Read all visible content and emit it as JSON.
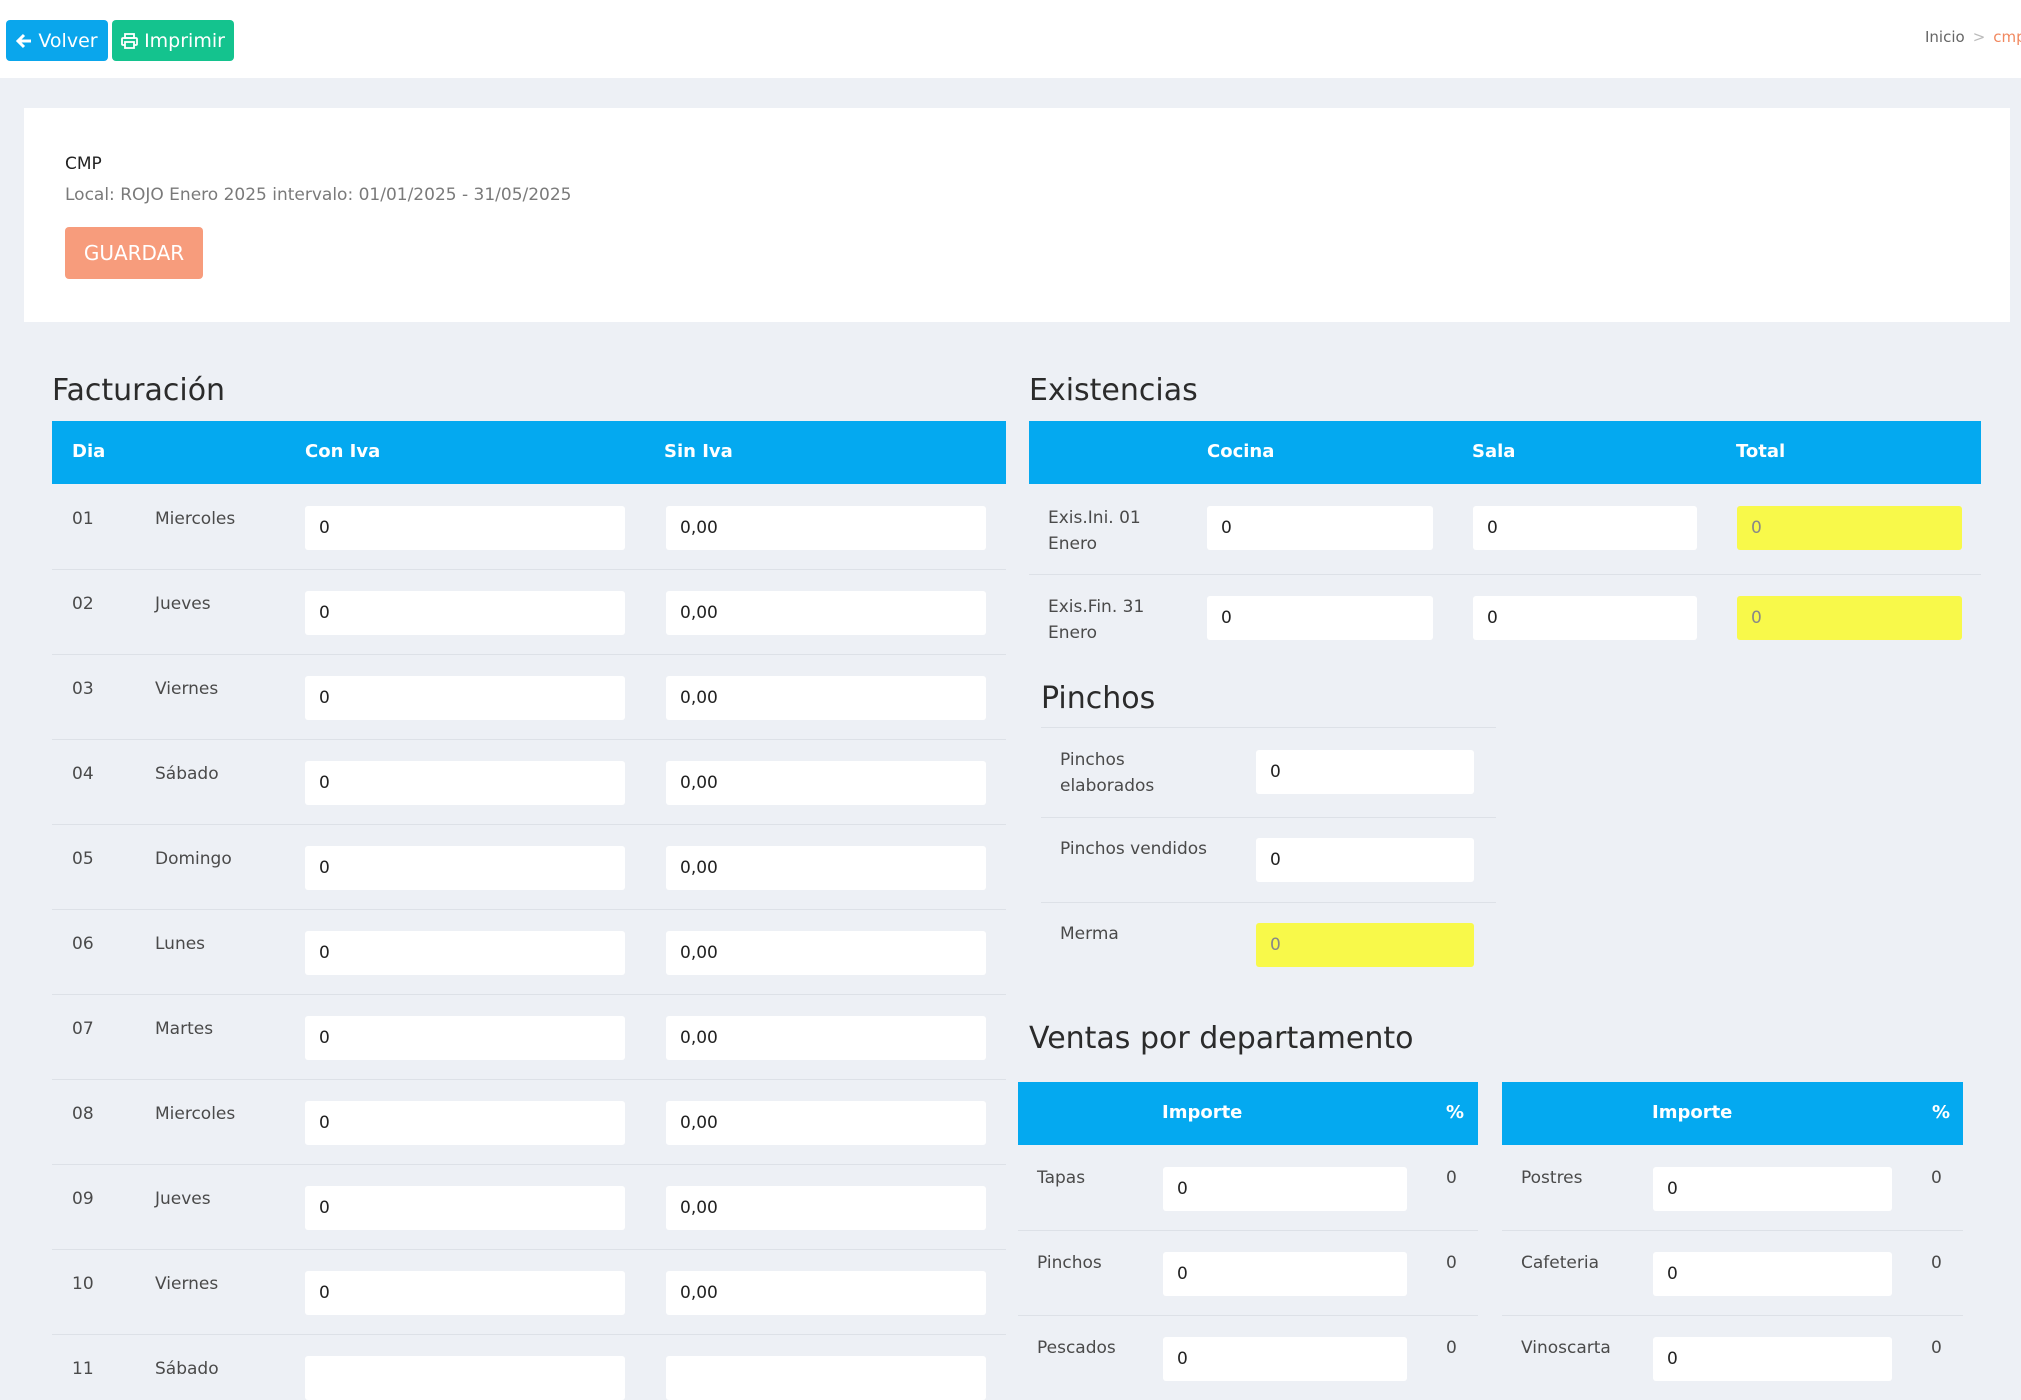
{
  "toolbar": {
    "back_label": "Volver",
    "print_label": "Imprimir"
  },
  "breadcrumb": {
    "home": "Inicio",
    "separator": ">",
    "current": "cmp"
  },
  "header": {
    "title": "CMP",
    "subtitle": "Local: ROJO Enero 2025 intervalo: 01/01/2025 - 31/05/2025",
    "save_label": "GUARDAR"
  },
  "facturacion": {
    "title": "Facturación",
    "columns": [
      "Dia",
      "Con Iva",
      "Sin Iva"
    ],
    "rows": [
      {
        "day": "01",
        "weekday": "Miercoles",
        "con_iva": "0",
        "sin_iva": "0,00"
      },
      {
        "day": "02",
        "weekday": "Jueves",
        "con_iva": "0",
        "sin_iva": "0,00"
      },
      {
        "day": "03",
        "weekday": "Viernes",
        "con_iva": "0",
        "sin_iva": "0,00"
      },
      {
        "day": "04",
        "weekday": "Sábado",
        "con_iva": "0",
        "sin_iva": "0,00"
      },
      {
        "day": "05",
        "weekday": "Domingo",
        "con_iva": "0",
        "sin_iva": "0,00"
      },
      {
        "day": "06",
        "weekday": "Lunes",
        "con_iva": "0",
        "sin_iva": "0,00"
      },
      {
        "day": "07",
        "weekday": "Martes",
        "con_iva": "0",
        "sin_iva": "0,00"
      },
      {
        "day": "08",
        "weekday": "Miercoles",
        "con_iva": "0",
        "sin_iva": "0,00"
      },
      {
        "day": "09",
        "weekday": "Jueves",
        "con_iva": "0",
        "sin_iva": "0,00"
      },
      {
        "day": "10",
        "weekday": "Viernes",
        "con_iva": "0",
        "sin_iva": "0,00"
      },
      {
        "day": "11",
        "weekday": "Sábado",
        "con_iva": "",
        "sin_iva": ""
      }
    ]
  },
  "existencias": {
    "title": "Existencias",
    "columns": [
      "Cocina",
      "Sala",
      "Total"
    ],
    "rows": [
      {
        "label_line1": "Exis.Ini. 01",
        "label_line2": "Enero",
        "cocina": "0",
        "sala": "0",
        "total": "0"
      },
      {
        "label_line1": "Exis.Fin. 31",
        "label_line2": "Enero",
        "cocina": "0",
        "sala": "0",
        "total": "0"
      }
    ]
  },
  "pinchos": {
    "title": "Pinchos",
    "rows": [
      {
        "label_line1": "Pinchos",
        "label_line2": "elaborados",
        "value": "0"
      },
      {
        "label_line1": "Pinchos vendidos",
        "label_line2": "",
        "value": "0"
      },
      {
        "label_line1": "Merma",
        "label_line2": "",
        "value": "0"
      }
    ]
  },
  "ventas": {
    "title": "Ventas por departamento",
    "tables": [
      {
        "columns": [
          "Importe",
          "%"
        ],
        "rows": [
          {
            "label": "Tapas",
            "importe": "0",
            "pct": "0"
          },
          {
            "label": "Pinchos",
            "importe": "0",
            "pct": "0"
          },
          {
            "label": "Pescados",
            "importe": "0",
            "pct": "0"
          }
        ]
      },
      {
        "columns": [
          "Importe",
          "%"
        ],
        "rows": [
          {
            "label": "Postres",
            "importe": "0",
            "pct": "0"
          },
          {
            "label": "Cafeteria",
            "importe": "0",
            "pct": "0"
          },
          {
            "label": "Vinoscarta",
            "importe": "0",
            "pct": "0"
          }
        ]
      }
    ]
  },
  "colors": {
    "accent_blue": "#04a9f0",
    "green": "#14c38e",
    "salmon": "#f79c7c",
    "highlight_yellow": "#f8f94a"
  }
}
